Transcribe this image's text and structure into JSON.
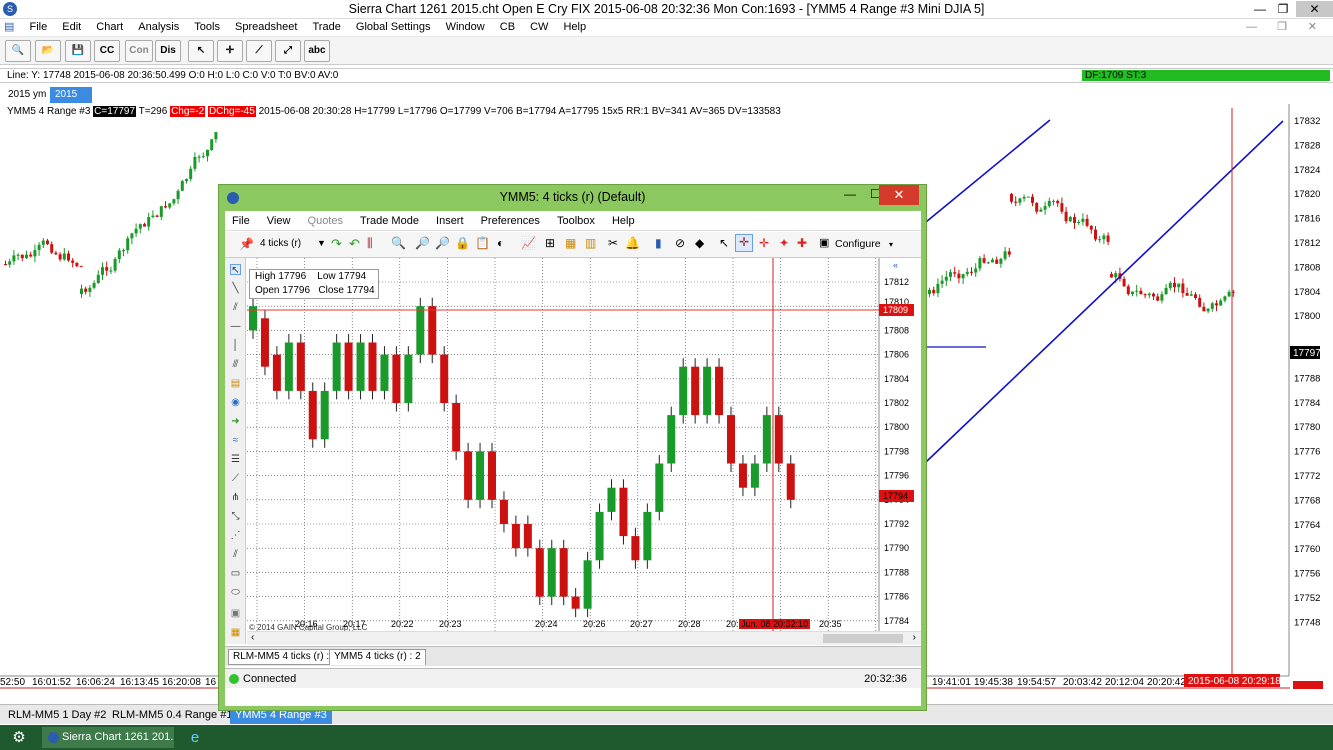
{
  "window": {
    "title": "Sierra Chart 1261 2015.cht  Open E Cry FIX 2015-06-08  20:32:36 Mon  Con:1693 - [YMM5  4 Range  #3  Mini DJIA 5]",
    "min_glyph": "—",
    "max_glyph": "❐",
    "close_glyph": "✕"
  },
  "menu": [
    "File",
    "Edit",
    "Chart",
    "Analysis",
    "Tools",
    "Spreadsheet",
    "Trade",
    "Global Settings",
    "Window",
    "CB",
    "CW",
    "Help"
  ],
  "toolbar": {
    "cc": "CC",
    "con": "Con",
    "dis": "Dis",
    "abc": "abc"
  },
  "status_line": {
    "text": "Line: Y: 17748  2015-06-08  20:36:50.499  O:0  H:0  L:0  C:0  V:0  T:0  BV:0  AV:0",
    "df": "DF:1709  ST:3"
  },
  "chart_tabs": {
    "label": "2015 ym",
    "active": "2015"
  },
  "info_line": {
    "prefix": "YMM5  4 Range  #3",
    "c": "C=17797",
    "t": "T=296",
    "chg": "Chg=-2",
    "dchg": "DChg=-45",
    "rest": "2015-06-08  20:30:28  H=17799  L=17796  O=17799  V=706  B=17794  A=17795  15x5  RR:1  BV=341  AV=365  DV=133583"
  },
  "bg_chart": {
    "price_labels": [
      "17832",
      "17828",
      "17824",
      "17820",
      "17816",
      "17812",
      "17808",
      "17804",
      "17800",
      "17797",
      "17792",
      "17788",
      "17784",
      "17780",
      "17776",
      "17772",
      "17768",
      "17764",
      "17760",
      "17756",
      "17752",
      "17748"
    ],
    "current_price": "17797",
    "time_labels_left": [
      "52:50",
      "16:01:52",
      "16:06:24",
      "16:13:45",
      "16:20:08",
      "16"
    ],
    "time_labels_right": [
      "19:41:01",
      "19:45:38",
      "19:54:57",
      "20:03:42",
      "20:12:04",
      "20:20:42"
    ],
    "cursor_time": "2015-06-08  20:29:18",
    "cursor_price": "17748"
  },
  "bottom_tabs": [
    "RLM-MM5  1 Day  #2",
    "RLM-MM5  0.4 Range  #1",
    "YMM5  4 Range  #3"
  ],
  "taskbar": {
    "app": "Sierra Chart 1261 201..."
  },
  "float_window": {
    "title": "YMM5: 4 ticks (r) (Default)",
    "menu": [
      "File",
      "View",
      "Quotes",
      "Trade Mode",
      "Insert",
      "Preferences",
      "Toolbox",
      "Help"
    ],
    "interval": "4 ticks (r)",
    "configure": "Configure",
    "ohlc": {
      "high": "High  17796",
      "low": "Low  17794",
      "open": "Open  17796",
      "close": "Close  17794"
    },
    "price_labels": [
      "17812",
      "17810",
      "17808",
      "17806",
      "17804",
      "17802",
      "17800",
      "17798",
      "17796",
      "17794",
      "17792",
      "17790",
      "17788",
      "17786",
      "17784"
    ],
    "price_marker_red": "17809",
    "price_marker_last": "17794",
    "time_labels": [
      "20:16",
      "20:17",
      "20:22",
      "20:23",
      "20:24",
      "20:26",
      "20:27",
      "20:28",
      "20:29",
      "20:35"
    ],
    "cursor_time": "Jun. 08 20:32:10",
    "copyright": "© 2014 GAIN Capital Group, LLC",
    "tabs": [
      "RLM-MM5 4 ticks (r) : 0",
      "YMM5 4 ticks (r) : 2"
    ],
    "status": "Connected",
    "clock": "20:32:36"
  },
  "colors": {
    "up": "#1a9a2a",
    "down": "#cc1111",
    "win_green": "#8cc860",
    "trend": "#1010cc"
  }
}
